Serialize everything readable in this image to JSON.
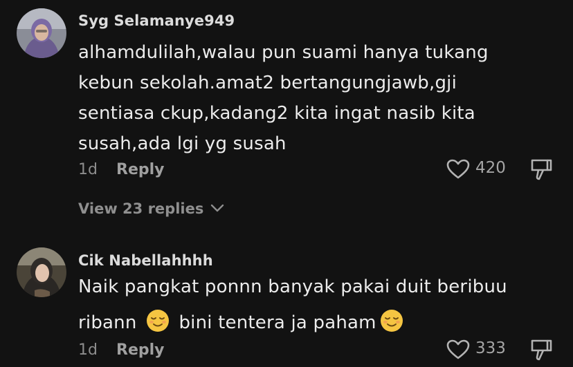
{
  "comments": [
    {
      "username": "Syg Selamanye949",
      "lines": [
        "alhamdulilah,walau pun suami hanya tukang",
        "kebun sekolah.amat2 bertangungjawb,gji",
        "sentiasa ckup,kadang2 kita ingat nasib kita",
        "susah,ada lgi yg susah"
      ],
      "age": "1d",
      "reply_label": "Reply",
      "likes": "420",
      "view_replies": "View 23 replies"
    },
    {
      "username": "Cik Nabellahhhh",
      "line1": "Naik pangkat ponnn banyak pakai duit beribuu",
      "line2_a": "ribann",
      "line2_b": "bini tentera ja paham",
      "age": "1d",
      "reply_label": "Reply",
      "likes": "333"
    }
  ],
  "icons": {
    "like": "heart-icon",
    "dislike": "thumbs-down-icon",
    "expand": "chevron-down-icon",
    "emoji": "relieved-face-emoji"
  },
  "colors": {
    "background": "#121212",
    "text": "#ececec",
    "muted": "#8d8d8d",
    "emoji": "#f5c542"
  }
}
